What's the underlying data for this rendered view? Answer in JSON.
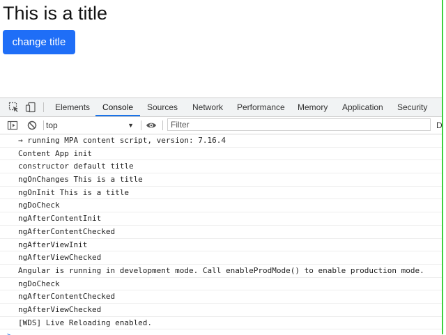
{
  "page": {
    "title": "This is a title",
    "button_label": "change title"
  },
  "devtools": {
    "tabs": [
      {
        "label": "Elements"
      },
      {
        "label": "Console",
        "active": true
      },
      {
        "label": "Sources"
      },
      {
        "label": "Network"
      },
      {
        "label": "Performance"
      },
      {
        "label": "Memory"
      },
      {
        "label": "Application"
      },
      {
        "label": "Security"
      }
    ],
    "toolbar": {
      "context": "top",
      "filter_placeholder": "Filter",
      "overflow_text": "D"
    },
    "console": {
      "messages": [
        "→ running MPA content script, version: 7.16.4",
        "Content App init",
        "constructor default title",
        "ngOnChanges This is a title",
        "ngOnInit This is a title",
        "ngDoCheck",
        "ngAfterContentInit",
        "ngAfterContentChecked",
        "ngAfterViewInit",
        "ngAfterViewChecked",
        "Angular is running in development mode. Call enableProdMode() to enable production mode.",
        "ngDoCheck",
        "ngAfterContentChecked",
        "ngAfterViewChecked",
        "[WDS] Live Reloading enabled."
      ],
      "prompt_symbol": ">"
    }
  },
  "colors": {
    "primary_button": "#1f6ef7",
    "active_tab_underline": "#1a73e8",
    "right_edge_line": "#3fd13f"
  }
}
